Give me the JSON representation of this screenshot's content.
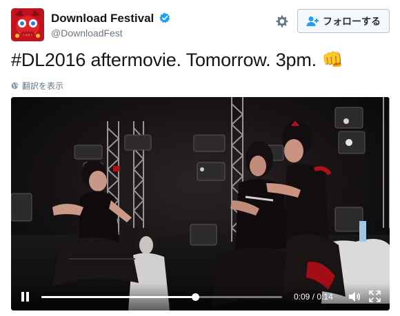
{
  "account": {
    "display_name": "Download Festival",
    "handle": "@DownloadFest",
    "verified": true,
    "avatar_icon": "red-mascot-avatar"
  },
  "actions": {
    "settings_icon": "gear-icon",
    "follow_label": "フォローする",
    "follow_icon": "person-add-icon"
  },
  "tweet": {
    "text": "#DL2016 aftermovie. Tomorrow. 3pm.",
    "emoji": "👊",
    "translate_label": "翻訳を表示"
  },
  "video": {
    "state": "playing",
    "current_time": "0:09",
    "separator": "/",
    "duration": "0:14",
    "progress": 0.64
  },
  "colors": {
    "brand_blue": "#1da1f2",
    "text": "#14171a",
    "muted": "#657786"
  }
}
